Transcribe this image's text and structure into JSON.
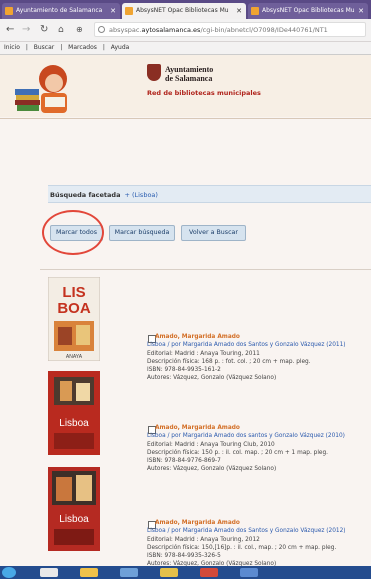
{
  "tabs": [
    {
      "label": "Ayuntamiento de Salamanca",
      "state": "inactive"
    },
    {
      "label": "AbsysNET Opac Bibliotecas Mu",
      "state": "active"
    },
    {
      "label": "AbsysNET Opac Bibliotecas Mu",
      "state": "inactive"
    }
  ],
  "address": {
    "prefix": "absyspac.",
    "domain": "aytosalamanca.es",
    "path": "/cgi-bin/abnetcl/O7098/IDe440761/NT1"
  },
  "bookmarks": [
    "Inicio",
    "Buscar",
    "Marcados",
    "Ayuda"
  ],
  "header": {
    "logo_line1": "Ayuntamiento",
    "logo_line2": "de Salamanca",
    "subtitle": "Red de bibliotecas municipales"
  },
  "facet": {
    "label": "Búsqueda facetada",
    "link": "+ (Lisboa)"
  },
  "buttons": {
    "mark_all": "Marcar todos",
    "mark_search": "Marcar búsqueda",
    "back_search": "Volver a Buscar"
  },
  "results": [
    {
      "author": "Amado, Margarida Amado",
      "title": "Lisboa / por Margarida Amado dos Santos y Gonzalo Vázquez (2011)",
      "publisher": "Editorial: Madrid : Anaya Touring, 2011",
      "description": "Descripción física: 168 p. : fot. col. ; 20 cm + map. pleg.",
      "isbn": "ISBN: 978-84-9935-161-2",
      "authors": "Autores: Vázquez, Gonzalo (Vázquez Solano)"
    },
    {
      "author": "Amado, Margarida Amado",
      "title": "Lisboa / por Margarida Amado dos santos y Gonzalo Vázquez (2010)",
      "publisher": "Editorial: Madrid : Anaya Touring Club, 2010",
      "description": "Descripción física: 150 p. : il. col. map. ; 20 cm + 1 map. pleg.",
      "isbn": "ISBN: 978-84-9776-869-7",
      "authors": "Autores: Vázquez, Gonzalo (Vázquez Solano)"
    },
    {
      "author": "Amado, Margarida Amado",
      "title": "Lisboa / por Margarida Amado dos Santos y Gonzalo Vázquez (2012)",
      "publisher": "Editorial: Madrid : Anaya Touring, 2012",
      "description": "Descripción física: 150,[16]p. : il. col., map. ; 20 cm + map. pleg.",
      "isbn": "ISBN: 978-84-9935-326-5",
      "authors": "Autores: Vázquez, Gonzalo (Vázquez Solano)"
    }
  ],
  "covers": [
    {
      "text_top": "LIS",
      "text_bottom": "BOA",
      "brand": "ANAYA"
    },
    {
      "text_top": "",
      "text_bottom": "Lisboa",
      "brand": ""
    },
    {
      "text_top": "",
      "text_bottom": "Lisboa",
      "brand": ""
    }
  ],
  "colors": {
    "accent_blue": "#2a59ad",
    "author_orange": "#d36f27",
    "highlight_red": "#e2473a",
    "tabbar": "#5a4a86",
    "taskbar": "#244c8e"
  }
}
